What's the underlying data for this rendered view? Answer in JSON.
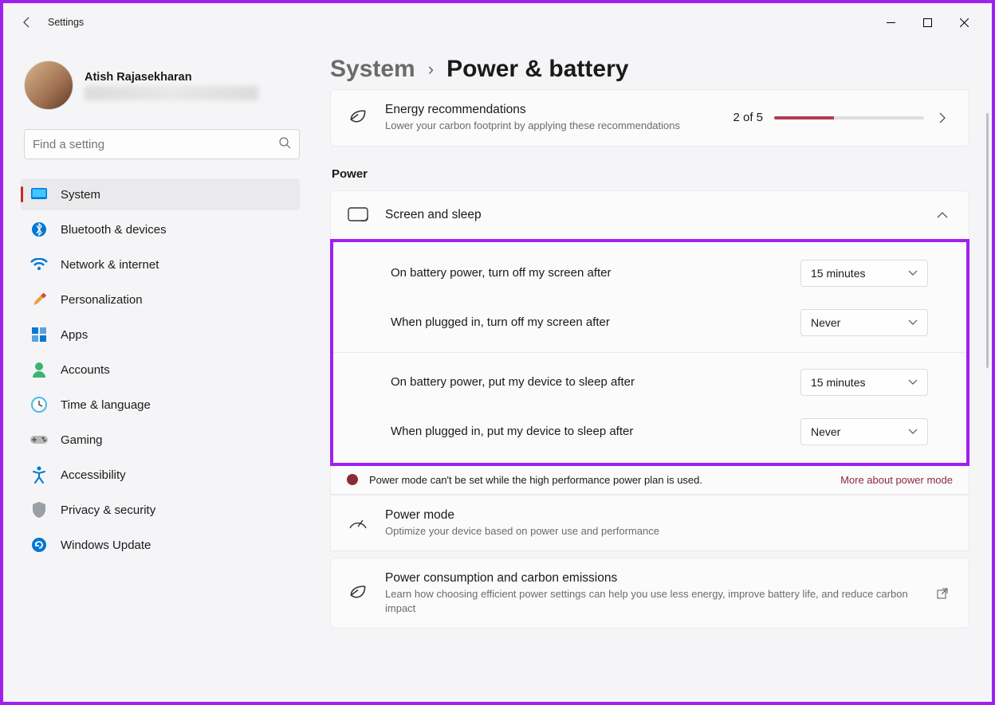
{
  "titlebar": {
    "app_title": "Settings"
  },
  "user": {
    "name": "Atish Rajasekharan"
  },
  "search": {
    "placeholder": "Find a setting"
  },
  "nav": [
    {
      "label": "System",
      "icon": "monitor-icon",
      "active": true
    },
    {
      "label": "Bluetooth & devices",
      "icon": "bluetooth-icon"
    },
    {
      "label": "Network & internet",
      "icon": "wifi-icon"
    },
    {
      "label": "Personalization",
      "icon": "brush-icon"
    },
    {
      "label": "Apps",
      "icon": "apps-icon"
    },
    {
      "label": "Accounts",
      "icon": "person-icon"
    },
    {
      "label": "Time & language",
      "icon": "clock-icon"
    },
    {
      "label": "Gaming",
      "icon": "gamepad-icon"
    },
    {
      "label": "Accessibility",
      "icon": "accessibility-icon"
    },
    {
      "label": "Privacy & security",
      "icon": "shield-icon"
    },
    {
      "label": "Windows Update",
      "icon": "update-icon"
    }
  ],
  "breadcrumb": {
    "parent": "System",
    "current": "Power & battery"
  },
  "energy": {
    "title": "Energy recommendations",
    "subtitle": "Lower your carbon footprint by applying these recommendations",
    "count_text": "2 of 5",
    "progress_pct": 40
  },
  "power": {
    "heading": "Power",
    "screen_sleep_title": "Screen and sleep",
    "settings": [
      {
        "label": "On battery power, turn off my screen after",
        "value": "15 minutes"
      },
      {
        "label": "When plugged in, turn off my screen after",
        "value": "Never"
      },
      {
        "label": "On battery power, put my device to sleep after",
        "value": "15 minutes"
      },
      {
        "label": "When plugged in, put my device to sleep after",
        "value": "Never"
      }
    ],
    "banner": {
      "text": "Power mode can't be set while the high performance power plan is used.",
      "link": "More about power mode"
    },
    "power_mode": {
      "title": "Power mode",
      "subtitle": "Optimize your device based on power use and performance"
    },
    "emissions": {
      "title": "Power consumption and carbon emissions",
      "subtitle": "Learn how choosing efficient power settings can help you use less energy, improve battery life, and reduce carbon impact"
    }
  }
}
